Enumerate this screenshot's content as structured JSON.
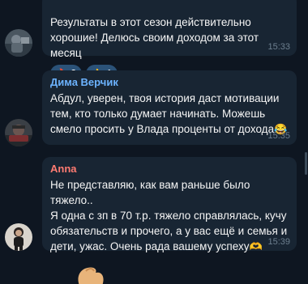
{
  "messages": [
    {
      "sender": "",
      "text": "Результаты в этот сезон действительно\nхорошие! Делюсь своим доходом за этот месяц",
      "time": "15:33",
      "reactions": [
        {
          "icon": "fire-icon",
          "emoji": "🔥",
          "count": "3"
        },
        {
          "icon": "thumbs-up-icon",
          "emoji": "👍",
          "count": "1"
        }
      ]
    },
    {
      "sender": "Дима Верчик",
      "sender_color": "#6cb3ff",
      "text": "Абдул, уверен, твоя история даст мотивации\nтем, кто только думает начинать. Можешь\nсмело просить у Влада проценты от дохода",
      "emoji": "😂",
      "time": "15:35"
    },
    {
      "sender": "Anna",
      "sender_color": "#ff7b72",
      "text": "Не представляю, как вам раньше было тяжело..\nЯ одна с зп в 70 т.р. тяжело справлялась, кучу\nобязательств и прочего, а у вас ещё и семья и\nдети, ужас. Очень рада вашему успеху",
      "emoji": "🫶",
      "time": "15:39"
    }
  ],
  "colors": {
    "background": "#0e1621",
    "bubble": "#182533",
    "reaction_bg": "#2b5278",
    "time": "#6d7f8f"
  }
}
